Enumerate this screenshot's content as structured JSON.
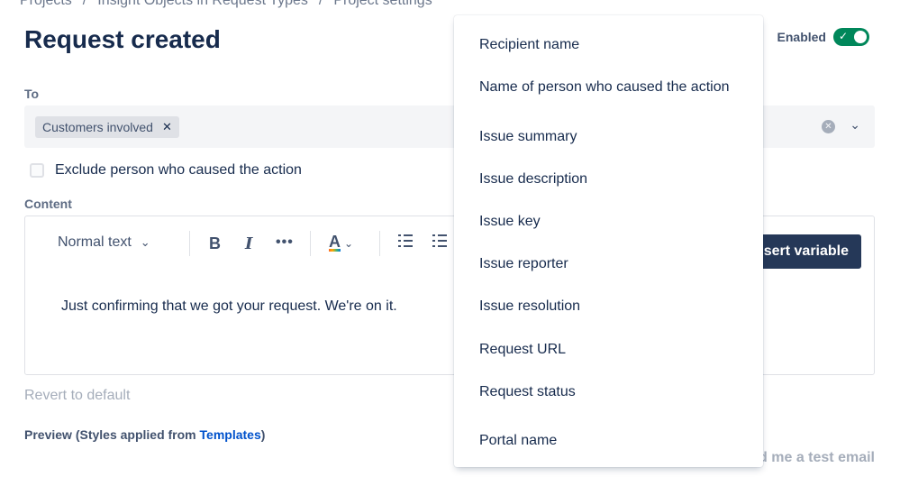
{
  "breadcrumb": {
    "items": [
      "Projects",
      "Insight Objects in Request Types",
      "Project settings"
    ],
    "separator": "/"
  },
  "header": {
    "title": "Request created",
    "enabled_label": "Enabled",
    "enabled": true
  },
  "to_field": {
    "label": "To",
    "chip_label": "Customers involved"
  },
  "exclude": {
    "label": "Exclude person who caused the action",
    "checked": false
  },
  "content": {
    "label": "Content",
    "toolbar": {
      "text_style": "Normal text",
      "bold": "B",
      "italic": "I",
      "more": "•••",
      "color": "A",
      "insert_variable": "Insert variable"
    },
    "body": "Just confirming that we got your request. We're on it."
  },
  "revert_label": "Revert to default",
  "preview": {
    "prefix": "Preview (Styles applied from ",
    "link": "Templates",
    "suffix": ")"
  },
  "test_email_label": "d me a test email",
  "variables_menu": {
    "items": [
      "Recipient name",
      "Name of person who caused the action",
      "Issue summary",
      "Issue description",
      "Issue key",
      "Issue reporter",
      "Issue resolution",
      "Request URL",
      "Request status",
      "Portal name"
    ]
  },
  "colors": {
    "accent": "#253858",
    "toggle_on": "#00875a",
    "link": "#0052cc"
  },
  "icons": {
    "clear": "clear-icon",
    "chevron": "chevron-down-icon",
    "remove_chip": "close-icon"
  }
}
